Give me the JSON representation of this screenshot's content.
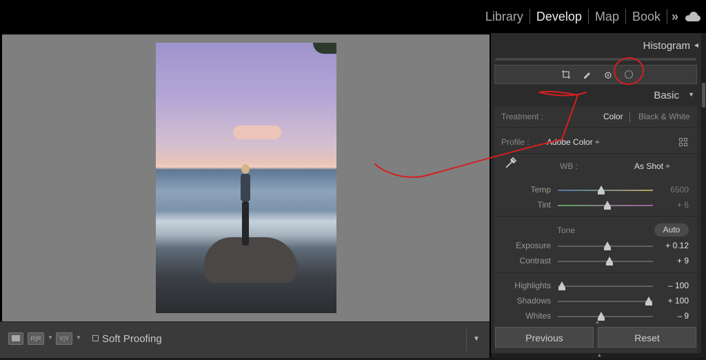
{
  "modules": {
    "library": "Library",
    "develop": "Develop",
    "map": "Map",
    "book": "Book",
    "more": "»"
  },
  "toolbar": {
    "before_after": "R|R",
    "before_after2": "Y|Y",
    "soft_proofing": "Soft Proofing"
  },
  "panel": {
    "histogram_title": "Histogram",
    "basic_title": "Basic",
    "treatment": {
      "label": "Treatment :",
      "color": "Color",
      "bw": "Black & White"
    },
    "profile": {
      "label": "Profile :",
      "value": "Adobe Color ÷"
    },
    "wb": {
      "label": "WB :",
      "value": "As Shot ÷"
    },
    "tone_label": "Tone",
    "auto_label": "Auto",
    "sliders": [
      {
        "label": "Temp",
        "value": "6500",
        "dim": true,
        "position": 0.46
      },
      {
        "label": "Tint",
        "value": "+ 6",
        "dim": true,
        "position": 0.52
      },
      {
        "label": "Exposure",
        "value": "+ 0.12",
        "dim": false,
        "position": 0.52
      },
      {
        "label": "Contrast",
        "value": "+ 9",
        "dim": false,
        "position": 0.54
      },
      {
        "label": "Highlights",
        "value": "– 100",
        "dim": false,
        "position": 0.04
      },
      {
        "label": "Shadows",
        "value": "+ 100",
        "dim": false,
        "position": 0.96
      },
      {
        "label": "Whites",
        "value": "– 9",
        "dim": false,
        "position": 0.46
      }
    ],
    "previous_label": "Previous",
    "reset_label": "Reset"
  },
  "colors": {
    "annotation": "#d61f1f",
    "panel_bg": "#2b2b2b",
    "view_bg": "#7f7f7f"
  },
  "icons": [
    "crop-overlay-icon",
    "spot-removal-icon",
    "red-eye-icon",
    "masking-icon",
    "eyedropper-icon",
    "profile-browser-icon",
    "cloud-icon"
  ]
}
